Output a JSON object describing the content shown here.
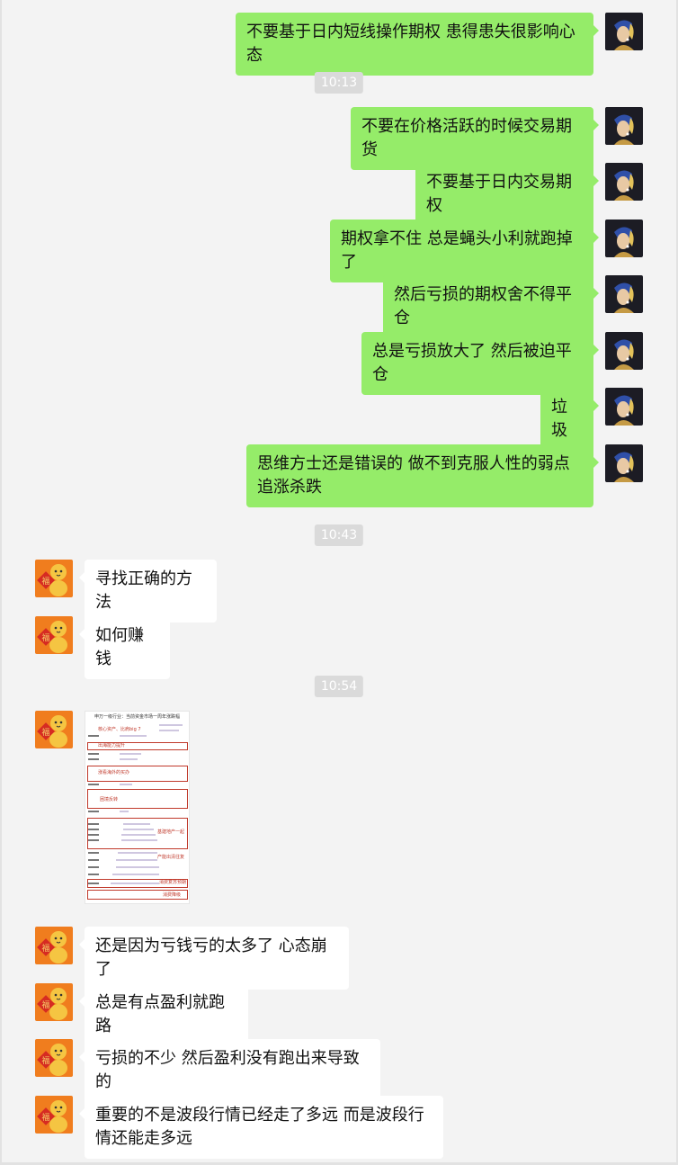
{
  "messages": [
    {
      "side": "me",
      "text": "不要基于日内短线操作期权 患得患失很影响心态"
    },
    {
      "time": "10:13"
    },
    {
      "side": "me",
      "text": "不要在价格活跃的时候交易期货"
    },
    {
      "side": "me",
      "text": "不要基于日内交易期权"
    },
    {
      "side": "me",
      "text": "期权拿不住 总是蝇头小利就跑掉了"
    },
    {
      "side": "me",
      "text": "然后亏损的期权舍不得平仓"
    },
    {
      "side": "me",
      "text": "总是亏损放大了 然后被迫平仓"
    },
    {
      "side": "me",
      "text": "垃圾"
    },
    {
      "side": "me",
      "text": "思维方士还是错误的 做不到克服人性的弱点 追涨杀跌"
    },
    {
      "time": "10:43"
    },
    {
      "side": "them",
      "text": "寻找正确的方法"
    },
    {
      "side": "them",
      "text": "如何赚钱"
    },
    {
      "time": "10:54"
    },
    {
      "side": "them",
      "image": true
    },
    {
      "side": "them",
      "text": "还是因为亏钱亏的太多了 心态崩了"
    },
    {
      "side": "them",
      "text": "总是有点盈利就跑路"
    },
    {
      "side": "them",
      "text": "亏损的不少 然后盈利没有跑出来导致的"
    },
    {
      "side": "them",
      "text": "重要的不是波段行情已经走了多远 而是波段行情还能走多远"
    }
  ],
  "image_thumbnail": {
    "title": "申万一级行业：当前资金市场一周年涨跌幅",
    "notes": [
      "核心资产、比肩big 7",
      "出海能力提升",
      "涨看海外的买办",
      "困境反转",
      "新能源产业链",
      "基建地产一起",
      "产能出清往复",
      "消费复苏预期",
      "周期补涨",
      "消费降级"
    ]
  },
  "colors": {
    "me_bubble": "#95ec69",
    "them_bubble": "#ffffff",
    "background": "#f3f3f3"
  }
}
